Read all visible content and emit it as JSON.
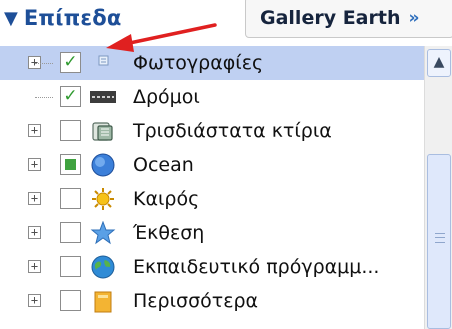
{
  "header": {
    "title": "Επίπεδα",
    "title_arrow_icon": "triangle-down-icon",
    "gallery_label": "Gallery Earth",
    "gallery_chevron": "»"
  },
  "layers": [
    {
      "label": "Φωτογραφίες",
      "checked": "checked",
      "icon": "photo-icon",
      "expandable": true,
      "selected": true
    },
    {
      "label": "Δρόμοι",
      "checked": "checked",
      "icon": "roads-icon",
      "expandable": false,
      "selected": false
    },
    {
      "label": "Τρισδιάστατα κτίρια",
      "checked": "unchecked",
      "icon": "buildings-3d-icon",
      "expandable": true,
      "selected": false
    },
    {
      "label": "Ocean",
      "checked": "partial",
      "icon": "ocean-globe-icon",
      "expandable": true,
      "selected": false
    },
    {
      "label": "Καιρός",
      "checked": "unchecked",
      "icon": "weather-sun-icon",
      "expandable": true,
      "selected": false
    },
    {
      "label": "Έκθεση",
      "checked": "unchecked",
      "icon": "gallery-star-icon",
      "expandable": true,
      "selected": false
    },
    {
      "label": "Εκπαιδευτικό πρόγραμμ...",
      "checked": "unchecked",
      "icon": "education-globe-icon",
      "expandable": true,
      "selected": false
    },
    {
      "label": "Περισσότερα",
      "checked": "unchecked",
      "icon": "more-folder-icon",
      "expandable": true,
      "selected": false
    }
  ],
  "colors": {
    "accent": "#1e4f98",
    "selection": "#bfd0f2",
    "annotation_arrow": "#e02020"
  }
}
